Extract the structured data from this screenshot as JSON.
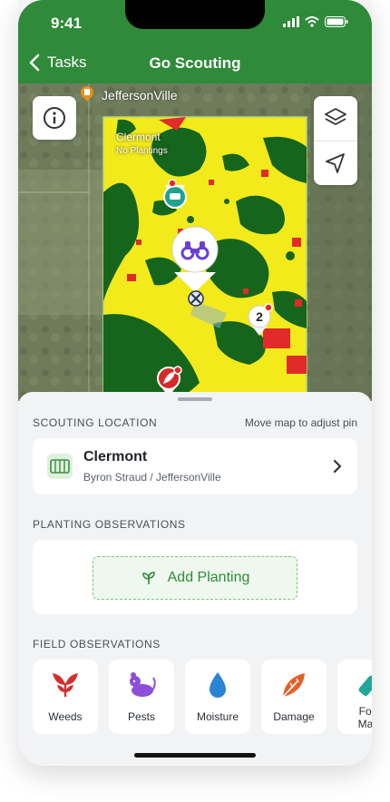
{
  "status": {
    "time": "9:41"
  },
  "nav": {
    "back_label": "Tasks",
    "title": "Go Scouting"
  },
  "map": {
    "city": "JeffersonVille",
    "field_name": "Clermont",
    "field_note": "No Plantings",
    "cluster_count": "2",
    "colors": {
      "yellow": "#f2ea1a",
      "green": "#16651c",
      "red": "#e12a2a"
    }
  },
  "scouting": {
    "section_title": "SCOUTING LOCATION",
    "hint": "Move map to adjust pin",
    "field_name": "Clermont",
    "field_sub": "Byron Straud / JeffersonVille"
  },
  "planting": {
    "section_title": "PLANTING OBSERVATIONS",
    "add_label": "Add Planting"
  },
  "field_obs": {
    "section_title": "FIELD OBSERVATIONS",
    "items": [
      {
        "label": "Weeds",
        "icon": "weed-icon"
      },
      {
        "label": "Pests",
        "icon": "pest-icon"
      },
      {
        "label": "Moisture",
        "icon": "water-drop-icon"
      },
      {
        "label": "Damage",
        "icon": "damage-icon"
      },
      {
        "label": "Fore",
        "label2": "Mate",
        "icon": "foreign-material-icon"
      }
    ]
  },
  "theme": {
    "primary": "#2f8a3a"
  }
}
